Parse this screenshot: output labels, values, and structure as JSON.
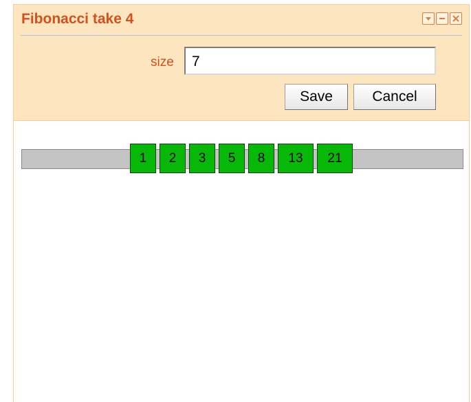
{
  "portlet": {
    "title": "Fibonacci take 4",
    "controls": [
      {
        "name": "dropdown-icon"
      },
      {
        "name": "minimize-icon"
      },
      {
        "name": "close-icon"
      }
    ]
  },
  "form": {
    "size_label": "size",
    "size_value": "7",
    "save_label": "Save",
    "cancel_label": "Cancel"
  },
  "sequence": {
    "values": [
      "1",
      "2",
      "3",
      "5",
      "8",
      "13",
      "21"
    ]
  },
  "colors": {
    "title": "#d3501c",
    "header_bg": "#fde6bf",
    "cell_fill": "#08b808",
    "track": "#c4c4c4"
  }
}
